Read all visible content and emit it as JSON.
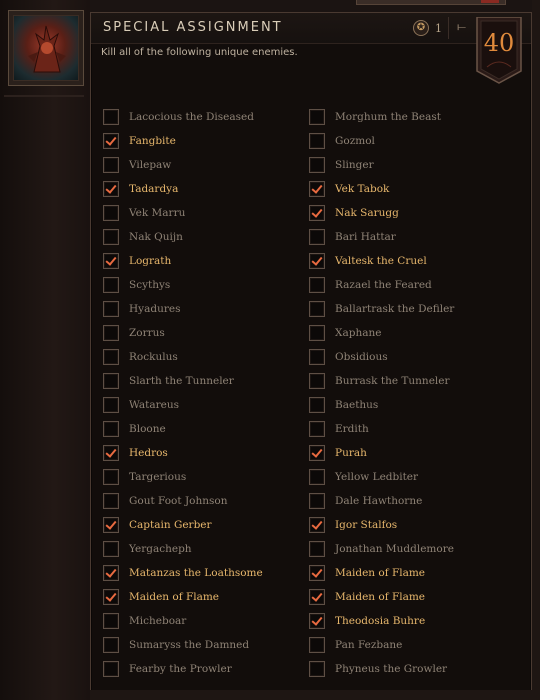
{
  "assignment": {
    "title": "SPECIAL ASSIGNMENT",
    "subtitle": "Kill all of the following unique enemies.",
    "reward_icon": "skull-coin-icon",
    "reward_count": "1",
    "level": "40"
  },
  "colors": {
    "checked_text": "#e6b66c",
    "unchecked_text": "#8e8275",
    "checkmark": "#e86a40",
    "level": "#e08a3c"
  },
  "enemies_left": [
    {
      "name": "Lacocious the Diseased",
      "checked": false
    },
    {
      "name": "Fangbite",
      "checked": true
    },
    {
      "name": "Vilepaw",
      "checked": false
    },
    {
      "name": "Tadardya",
      "checked": true
    },
    {
      "name": "Vek Marru",
      "checked": false
    },
    {
      "name": "Nak Quijn",
      "checked": false
    },
    {
      "name": "Lograth",
      "checked": true
    },
    {
      "name": "Scythys",
      "checked": false
    },
    {
      "name": "Hyadures",
      "checked": false
    },
    {
      "name": "Zorrus",
      "checked": false
    },
    {
      "name": "Rockulus",
      "checked": false
    },
    {
      "name": "Slarth the Tunneler",
      "checked": false
    },
    {
      "name": "Watareus",
      "checked": false
    },
    {
      "name": "Bloone",
      "checked": false
    },
    {
      "name": "Hedros",
      "checked": true
    },
    {
      "name": "Targerious",
      "checked": false
    },
    {
      "name": "Gout Foot Johnson",
      "checked": false
    },
    {
      "name": "Captain Gerber",
      "checked": true
    },
    {
      "name": "Yergacheph",
      "checked": false
    },
    {
      "name": "Matanzas the Loathsome",
      "checked": true
    },
    {
      "name": "Maiden of Flame",
      "checked": true
    },
    {
      "name": "Micheboar",
      "checked": false
    },
    {
      "name": "Sumaryss the Damned",
      "checked": false
    },
    {
      "name": "Fearby the Prowler",
      "checked": false
    }
  ],
  "enemies_right": [
    {
      "name": "Morghum the Beast",
      "checked": false
    },
    {
      "name": "Gozmol",
      "checked": false
    },
    {
      "name": "Slinger",
      "checked": false
    },
    {
      "name": "Vek Tabok",
      "checked": true
    },
    {
      "name": "Nak Sarugg",
      "checked": true
    },
    {
      "name": "Bari Hattar",
      "checked": false
    },
    {
      "name": "Valtesk the Cruel",
      "checked": true
    },
    {
      "name": "Razael the Feared",
      "checked": false
    },
    {
      "name": "Ballartrask the Defiler",
      "checked": false
    },
    {
      "name": "Xaphane",
      "checked": false
    },
    {
      "name": "Obsidious",
      "checked": false
    },
    {
      "name": "Burrask the Tunneler",
      "checked": false
    },
    {
      "name": "Baethus",
      "checked": false
    },
    {
      "name": "Erdith",
      "checked": false
    },
    {
      "name": "Purah",
      "checked": true
    },
    {
      "name": "Yellow Ledbiter",
      "checked": false
    },
    {
      "name": "Dale Hawthorne",
      "checked": false
    },
    {
      "name": "Igor Stalfos",
      "checked": true
    },
    {
      "name": "Jonathan Muddlemore",
      "checked": false
    },
    {
      "name": "Maiden of Flame",
      "checked": true
    },
    {
      "name": "Maiden of Flame",
      "checked": true
    },
    {
      "name": "Theodosia Buhre",
      "checked": true
    },
    {
      "name": "Pan Fezbane",
      "checked": false
    },
    {
      "name": "Phyneus the Growler",
      "checked": false
    }
  ]
}
